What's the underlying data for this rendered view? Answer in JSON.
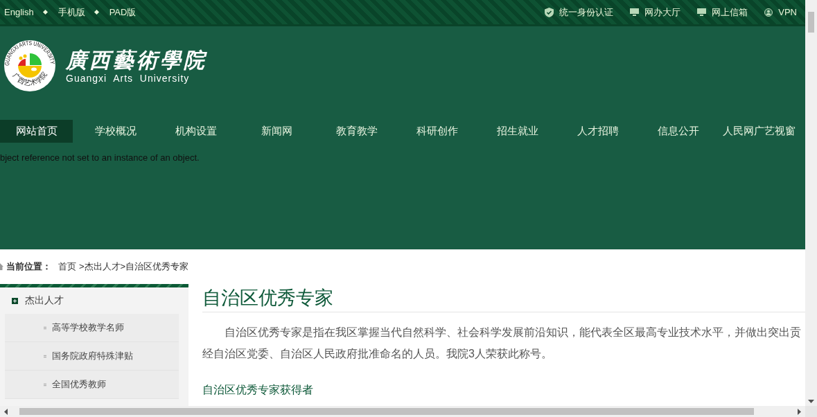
{
  "top_links": [
    {
      "label": "English"
    },
    {
      "label": "手机版"
    },
    {
      "label": "PAD版"
    }
  ],
  "service_links": [
    {
      "label": "统一身份认证",
      "kind": "shield"
    },
    {
      "label": "网办大厅",
      "kind": "monitor"
    },
    {
      "label": "网上信箱",
      "kind": "monitor"
    },
    {
      "label": "VPN",
      "kind": "user"
    }
  ],
  "logo": {
    "ring_top": "GUANGXI ARTS UNIVERSITY",
    "ring_bottom": "广西艺术学院",
    "name_cn": "廣西藝術學院",
    "name_en": "Guangxi  Arts  University"
  },
  "nav": [
    {
      "label": "网站首页",
      "selected": true
    },
    {
      "label": "学校概况",
      "selected": false
    },
    {
      "label": "机构设置",
      "selected": false
    },
    {
      "label": "新闻网",
      "selected": false
    },
    {
      "label": "教育教学",
      "selected": false
    },
    {
      "label": "科研创作",
      "selected": false
    },
    {
      "label": "招生就业",
      "selected": false
    },
    {
      "label": "人才招聘",
      "selected": false
    },
    {
      "label": "信息公开",
      "selected": false
    },
    {
      "label": "人民网广艺视窗",
      "selected": false
    }
  ],
  "error_message": "bject reference not set to an instance of an object.",
  "breadcrumb": {
    "label": "当前位置：",
    "trail": [
      "首页",
      ">杰出人才>自治区优秀专家"
    ]
  },
  "sidebar": {
    "heading": "杰出人才",
    "items": [
      "高等学校教学名师",
      "国务院政府特殊津贴",
      "全国优秀教师"
    ]
  },
  "article": {
    "title": "自治区优秀专家",
    "paragraph_lines": [
      "自治区优秀专家是指在我区掌握当代自然科学、社会科学发展前沿知识，能代表全区最高专业技术水平，并做出突出贡",
      "经自治区党委、自治区人民政府批准命名的人员。我院3人荣获此称号。"
    ],
    "subtitle": "自治区优秀专家获得者"
  }
}
